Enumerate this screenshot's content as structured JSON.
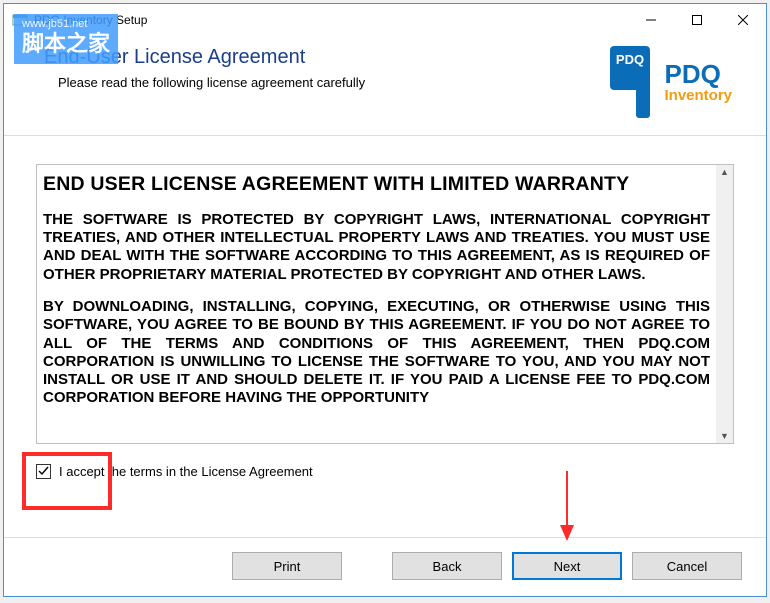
{
  "window": {
    "title": "PDQ Inventory Setup"
  },
  "header": {
    "heading": "End-User License Agreement",
    "subheading": "Please read the following license agreement carefully",
    "logo": {
      "brand_top": "PDQ",
      "brand_main": "PDQ",
      "brand_sub": "Inventory"
    }
  },
  "eula": {
    "title": "END USER LICENSE AGREEMENT WITH LIMITED WARRANTY",
    "para1": "THE SOFTWARE IS PROTECTED BY COPYRIGHT LAWS, INTERNATIONAL COPYRIGHT TREATIES, AND OTHER INTELLECTUAL PROPERTY LAWS AND TREATIES. YOU MUST USE AND DEAL WITH THE SOFTWARE ACCORDING TO THIS AGREEMENT, AS IS REQUIRED OF OTHER PROPRIETARY MATERIAL PROTECTED BY COPYRIGHT AND OTHER LAWS.",
    "para2": "BY DOWNLOADING, INSTALLING, COPYING, EXECUTING, OR OTHERWISE USING THIS SOFTWARE, YOU AGREE TO BE BOUND BY THIS AGREEMENT. IF YOU DO NOT AGREE TO ALL OF THE TERMS AND CONDITIONS OF THIS AGREEMENT, THEN PDQ.COM CORPORATION IS UNWILLING TO LICENSE THE SOFTWARE TO YOU, AND YOU MAY NOT INSTALL OR USE IT AND SHOULD DELETE IT. IF YOU PAID A LICENSE FEE TO PDQ.COM CORPORATION BEFORE HAVING THE OPPORTUNITY"
  },
  "accept": {
    "checked": true,
    "label": "I accept the terms in the License Agreement"
  },
  "buttons": {
    "print": "Print",
    "back": "Back",
    "next": "Next",
    "cancel": "Cancel"
  },
  "watermark": {
    "url": "www.jb51.net",
    "text": "脚本之家"
  }
}
